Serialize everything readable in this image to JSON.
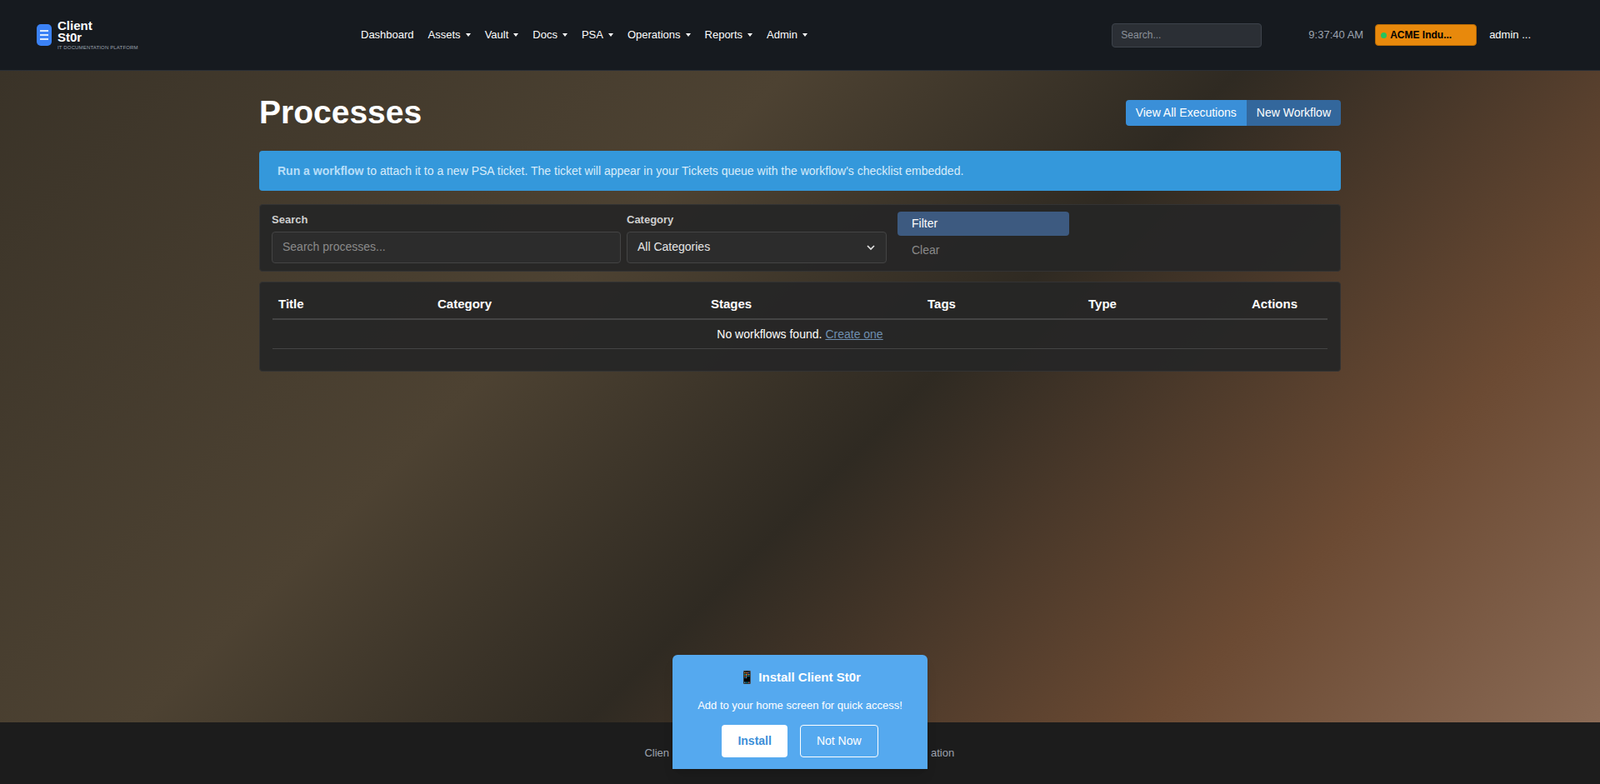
{
  "header": {
    "logo": {
      "line1": "Client",
      "line2": "St0r",
      "tagline": "IT DOCUMENTATION PLATFORM"
    },
    "nav": [
      {
        "label": "Dashboard",
        "dropdown": false
      },
      {
        "label": "Assets",
        "dropdown": true
      },
      {
        "label": "Vault",
        "dropdown": true
      },
      {
        "label": "Docs",
        "dropdown": true
      },
      {
        "label": "PSA",
        "dropdown": true
      },
      {
        "label": "Operations",
        "dropdown": true
      },
      {
        "label": "Reports",
        "dropdown": true
      },
      {
        "label": "Admin",
        "dropdown": true
      }
    ],
    "search": {
      "placeholder": "Search..."
    },
    "time": "9:37:40 AM",
    "org": {
      "label": "ACME Indu...",
      "color": "#22c55e"
    },
    "user": "admin ..."
  },
  "page": {
    "title": "Processes",
    "buttons": [
      {
        "label": "View All Executions",
        "color": "#3a8fd8"
      },
      {
        "label": "New Workflow",
        "color": "#33679c"
      }
    ],
    "alert": {
      "link": "Run a workflow",
      "text": " to attach it to a new PSA ticket. The ticket will appear in your Tickets queue with the workflow's checklist embedded."
    },
    "filters": {
      "search_label": "Search",
      "search_placeholder": "Search processes...",
      "category_label": "Category",
      "category_value": "All Categories",
      "filter_button": "Filter",
      "clear_button": "Clear"
    },
    "table": {
      "columns": [
        "Title",
        "Category",
        "Stages",
        "Tags",
        "Type",
        "Actions"
      ],
      "empty_text": "No workflows found.",
      "empty_link": "Create one"
    }
  },
  "footer": {
    "left": "Clien",
    "right": "ation"
  },
  "install_popup": {
    "icon": "📱",
    "title": "Install Client St0r",
    "text": "Add to your home screen for quick access!",
    "buttons": [
      "Install",
      "Not Now"
    ]
  }
}
